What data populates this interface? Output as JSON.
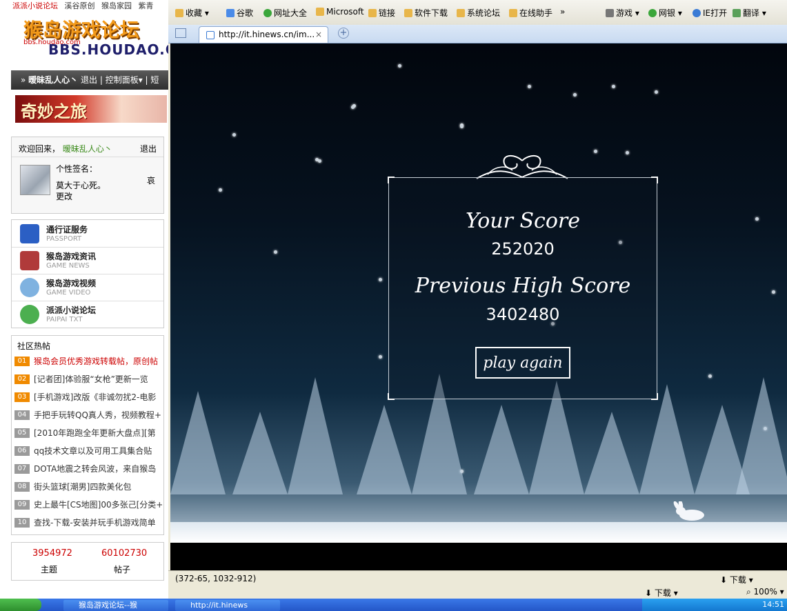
{
  "forum": {
    "top_links": [
      "派派小说论坛",
      "溪谷原创",
      "猴岛家园",
      "紫青"
    ],
    "logo_line1": "猴岛游戏论坛",
    "logo_line2": "BBS.HOUDAO.COM",
    "logo_small": "bbs.houdao.com",
    "userbar": {
      "username": "暧昧乱人心丶",
      "logout": "退出",
      "control_panel": "控制面板",
      "extra": "短"
    },
    "banner_text": "奇妙之旅",
    "welcome": {
      "greeting": "欢迎回来，",
      "username": "暧昧乱人心丶",
      "logout": "退出",
      "sig_label": "个性签名：",
      "sig_text": "莫大于心死。",
      "edit": "更改",
      "aside": "哀"
    },
    "services": [
      {
        "title": "通行证服务",
        "sub": "PASSPORT",
        "color": "#2b5fc4"
      },
      {
        "title": "猴岛游戏资讯",
        "sub": "GAME NEWS",
        "color": "#b03a3a"
      },
      {
        "title": "猴岛游戏视频",
        "sub": "GAME VIDEO",
        "color": "#7fb2e0"
      },
      {
        "title": "派派小说论坛",
        "sub": "PAIPAI TXT",
        "color": "#4caf50"
      }
    ],
    "hot_title": "社区热帖",
    "hot_posts": [
      {
        "num": "01",
        "text": "猴岛会员优秀游戏转载帖，原创帖"
      },
      {
        "num": "02",
        "text": "[记者团]体验服“女枪”更新一览"
      },
      {
        "num": "03",
        "text": "[手机游戏]改版《非诚勿扰2-电影"
      },
      {
        "num": "04",
        "text": "手把手玩转QQ真人秀，视频教程+"
      },
      {
        "num": "05",
        "text": "[2010年跑跑全年更新大盘点][第"
      },
      {
        "num": "06",
        "text": "qq技术文章以及可用工具集合贴"
      },
      {
        "num": "07",
        "text": "DOTA地震之转会风波，来自猴岛"
      },
      {
        "num": "08",
        "text": "街头篮球[潮男]四款美化包"
      },
      {
        "num": "09",
        "text": "史上最牛[CS地图]00多张己[分类+"
      },
      {
        "num": "10",
        "text": "查找-下载-安装并玩手机游戏简单"
      }
    ],
    "stats": {
      "topics_value": "3954972",
      "topics_label": "主题",
      "posts_value": "60102730",
      "posts_label": "帖子"
    }
  },
  "browser": {
    "favorites": [
      "收藏",
      "谷歌",
      "网址大全",
      "Microsoft",
      "链接",
      "软件下载",
      "系统论坛",
      "在线助手",
      "»",
      "游戏",
      "网银",
      "IE打开",
      "翻译"
    ],
    "tab_title": "http://it.hinews.cn/im...",
    "tab_close": "×",
    "new_tab": "+"
  },
  "game": {
    "score_label": "Your Score",
    "score_value": "252020",
    "high_label": "Previous High Score",
    "high_value": "3402480",
    "play_again": "play again"
  },
  "status": {
    "coords": "(372-65, 1032-912)",
    "download": "下载",
    "download2": "下载",
    "zoom": "100%"
  },
  "taskbar": {
    "task1": "猴岛游戏论坛--猴",
    "task2": "http://it.hinews",
    "clock": "14:51"
  }
}
